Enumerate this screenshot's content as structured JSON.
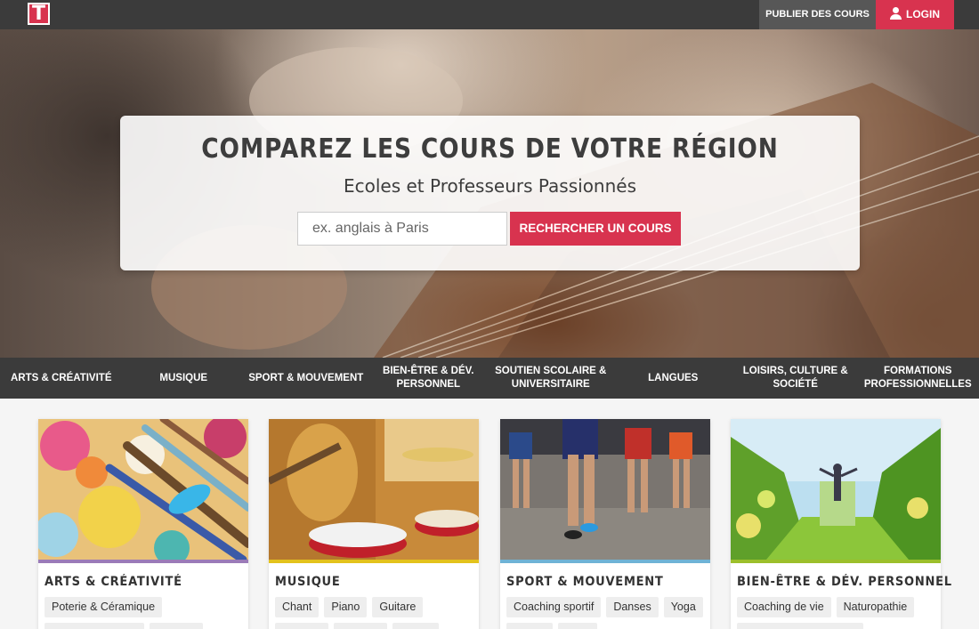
{
  "header": {
    "logo_letter": "T",
    "publish_label": "PUBLIER DES COURS",
    "login_label": "LOGIN"
  },
  "hero": {
    "title": "COMPAREZ LES COURS DE VOTRE RÉGION",
    "subtitle": "Ecoles et Professeurs Passionnés",
    "search_placeholder": "ex. anglais à Paris",
    "search_button": "RECHERCHER UN COURS"
  },
  "nav": {
    "items": [
      {
        "label": "ARTS & CRÉATIVITÉ"
      },
      {
        "label": "MUSIQUE"
      },
      {
        "label": "SPORT & MOUVEMENT"
      },
      {
        "label": "BIEN-ÊTRE & DÉV. PERSONNEL"
      },
      {
        "label": "SOUTIEN SCOLAIRE & UNIVERSITAIRE"
      },
      {
        "label": "LANGUES"
      },
      {
        "label": "LOISIRS, CULTURE & SOCIÉTÉ"
      },
      {
        "label": "FORMATIONS PROFESSIONNELLES"
      }
    ]
  },
  "cards": [
    {
      "title": "ARTS & CRÉATIVITÉ",
      "accent": "#9b7bb8",
      "tags": [
        "Poterie & Céramique"
      ]
    },
    {
      "title": "MUSIQUE",
      "accent": "#e3c21c",
      "tags": [
        "Chant",
        "Piano",
        "Guitare"
      ]
    },
    {
      "title": "SPORT & MOUVEMENT",
      "accent": "#6fb3d6",
      "tags": [
        "Coaching sportif",
        "Danses",
        "Yoga"
      ]
    },
    {
      "title": "BIEN-ÊTRE & DÉV. PERSONNEL",
      "accent": "#9cbf2b",
      "tags": [
        "Coaching de vie",
        "Naturopathie"
      ]
    }
  ],
  "colors": {
    "brand": "#d8334f",
    "dark_bar": "#3b3b3b"
  }
}
